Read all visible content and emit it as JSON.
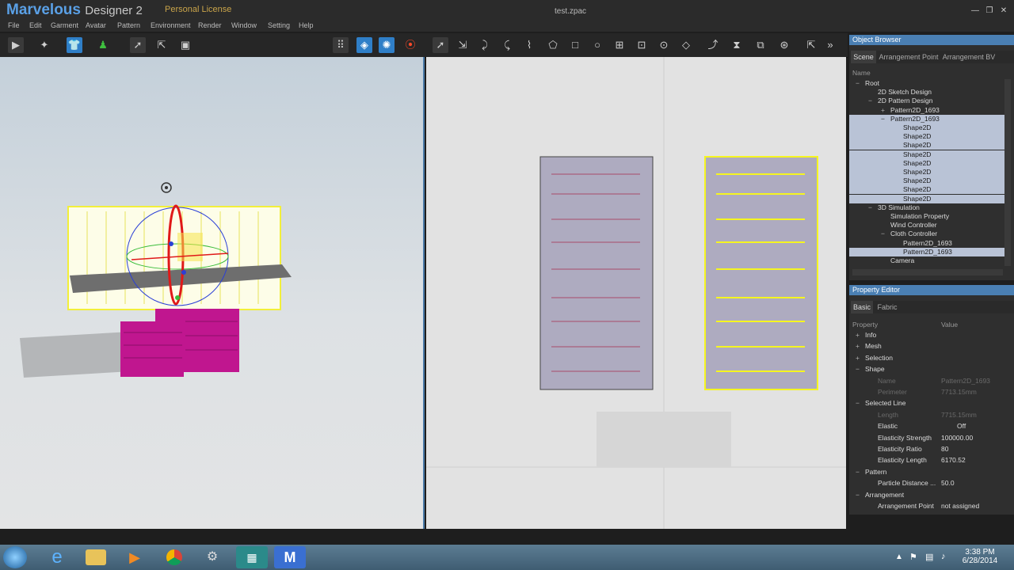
{
  "app": {
    "brand": "Marvelous",
    "brand_sub": "Designer 2",
    "license": "Personal License",
    "filename": "test.zpac"
  },
  "window_controls": [
    "—",
    "❐",
    "✕"
  ],
  "menu": [
    "File",
    "Edit",
    "Garment",
    "Avatar",
    "Pattern",
    "Environment",
    "Render",
    "Window",
    "Setting",
    "Help"
  ],
  "object_browser": {
    "title": "Object Browser",
    "tabs": [
      "Scene",
      "Arrangement Point",
      "Arrangement BV"
    ],
    "column": "Name",
    "items": [
      {
        "label": "Root",
        "level": 0,
        "exp": "−",
        "sel": false
      },
      {
        "label": "2D Sketch Design",
        "level": 1,
        "exp": "",
        "sel": false
      },
      {
        "label": "2D Pattern Design",
        "level": 1,
        "exp": "−",
        "sel": false
      },
      {
        "label": "Pattern2D_1693",
        "level": 2,
        "exp": "+",
        "sel": false
      },
      {
        "label": "Pattern2D_1693",
        "level": 2,
        "exp": "−",
        "sel": true
      },
      {
        "label": "Shape2D",
        "level": 3,
        "exp": "",
        "sel": true
      },
      {
        "label": "Shape2D",
        "level": 3,
        "exp": "",
        "sel": true
      },
      {
        "label": "Shape2D",
        "level": 3,
        "exp": "",
        "sel": true
      },
      {
        "label": "Shape2D",
        "level": 3,
        "exp": "",
        "sel": true
      },
      {
        "label": "Shape2D",
        "level": 3,
        "exp": "",
        "sel": true
      },
      {
        "label": "Shape2D",
        "level": 3,
        "exp": "",
        "sel": true
      },
      {
        "label": "Shape2D",
        "level": 3,
        "exp": "",
        "sel": true
      },
      {
        "label": "Shape2D",
        "level": 3,
        "exp": "",
        "sel": true
      },
      {
        "label": "Shape2D",
        "level": 3,
        "exp": "",
        "sel": true
      },
      {
        "label": "3D Simulation",
        "level": 1,
        "exp": "−",
        "sel": false
      },
      {
        "label": "Simulation Property",
        "level": 2,
        "exp": "",
        "sel": false
      },
      {
        "label": "Wind Controller",
        "level": 2,
        "exp": "",
        "sel": false
      },
      {
        "label": "Cloth Controller",
        "level": 2,
        "exp": "−",
        "sel": false
      },
      {
        "label": "Pattern2D_1693",
        "level": 3,
        "exp": "",
        "sel": false
      },
      {
        "label": "Pattern2D_1693",
        "level": 3,
        "exp": "",
        "sel": true
      },
      {
        "label": "Camera",
        "level": 2,
        "exp": "",
        "sel": false
      }
    ]
  },
  "property_editor": {
    "title": "Property Editor",
    "tabs": [
      "Basic",
      "Fabric"
    ],
    "col_property": "Property",
    "col_value": "Value",
    "rows": [
      {
        "label": "Info",
        "value": "",
        "type": "group",
        "exp": "+"
      },
      {
        "label": "Mesh",
        "value": "",
        "type": "group",
        "exp": "+"
      },
      {
        "label": "Selection",
        "value": "",
        "type": "group",
        "exp": "+"
      },
      {
        "label": "Shape",
        "value": "",
        "type": "group",
        "exp": "−"
      },
      {
        "label": "Name",
        "value": "Pattern2D_1693",
        "type": "dim"
      },
      {
        "label": "Perimeter",
        "value": "7713.15mm",
        "type": "dim"
      },
      {
        "label": "Selected Line",
        "value": "",
        "type": "group",
        "exp": "−"
      },
      {
        "label": "Length",
        "value": "7715.15mm",
        "type": "dim"
      },
      {
        "label": "Elastic",
        "value": "Off",
        "type": "prop"
      },
      {
        "label": "Elasticity Strength",
        "value": "100000.00",
        "type": "prop"
      },
      {
        "label": "Elasticity Ratio",
        "value": "80",
        "type": "prop"
      },
      {
        "label": "Elasticity Length",
        "value": "6170.52",
        "type": "prop"
      },
      {
        "label": "Pattern",
        "value": "",
        "type": "group",
        "exp": "−"
      },
      {
        "label": "Particle Distance ...",
        "value": "50.0",
        "type": "prop"
      },
      {
        "label": "Arrangement",
        "value": "",
        "type": "group",
        "exp": "−"
      },
      {
        "label": "Arrangement Point",
        "value": "not assigned",
        "type": "prop"
      }
    ]
  },
  "taskbar": {
    "time": "3:38 PM",
    "date": "6/28/2014"
  }
}
